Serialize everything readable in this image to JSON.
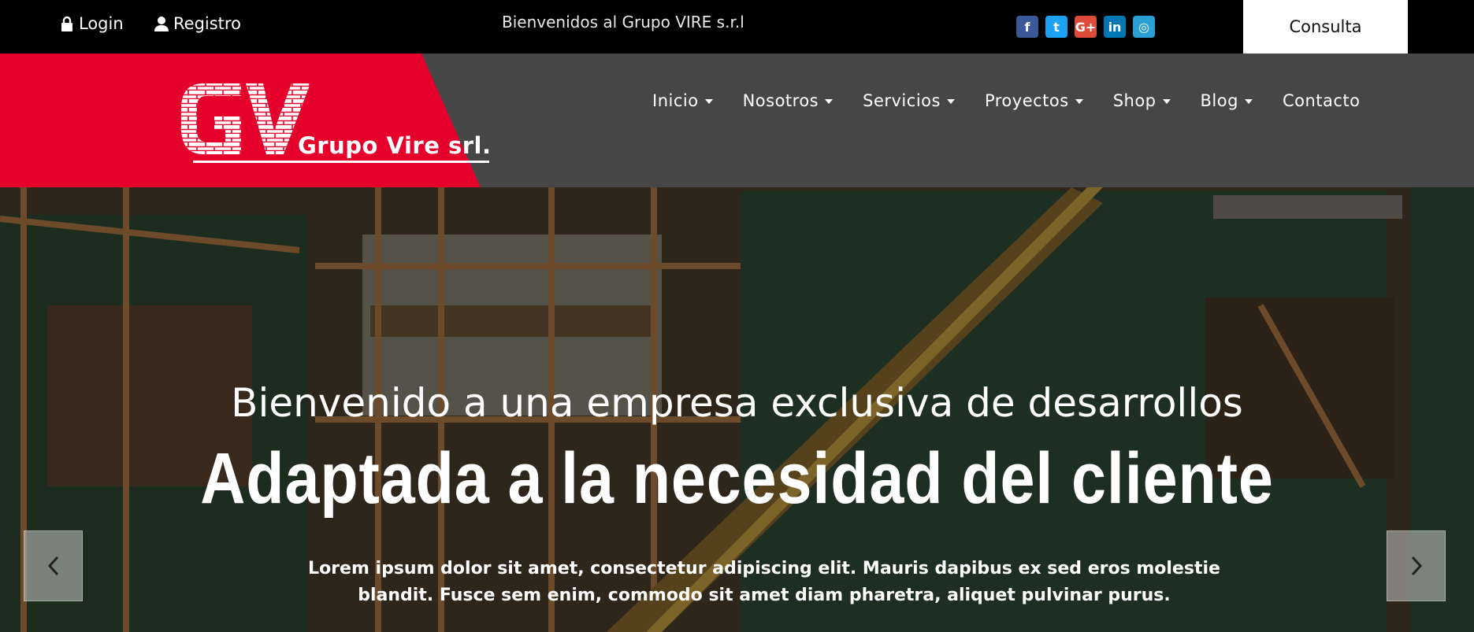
{
  "topbar": {
    "login_label": "Login",
    "register_label": "Registro",
    "welcome": "Bienvenidos al Grupo VIRE s.r.l",
    "socials": [
      {
        "icon": "facebook-icon",
        "glyph": "f",
        "color": "#3b5998"
      },
      {
        "icon": "twitter-icon",
        "glyph": "t",
        "color": "#1da1f2"
      },
      {
        "icon": "google-plus-icon",
        "glyph": "G+",
        "color": "#dd4b39"
      },
      {
        "icon": "linkedin-icon",
        "glyph": "in",
        "color": "#0077b5"
      },
      {
        "icon": "instagram-icon",
        "glyph": "◎",
        "color": "#2a9fd6"
      }
    ],
    "consulta_label": "Consulta"
  },
  "header": {
    "logo_monogram": "GV",
    "logo_text": "Grupo Vire srl.",
    "brand_color": "#e4002b",
    "nav": [
      {
        "label": "Inicio",
        "has_dropdown": true
      },
      {
        "label": "Nosotros",
        "has_dropdown": true
      },
      {
        "label": "Servicios",
        "has_dropdown": true
      },
      {
        "label": "Proyectos",
        "has_dropdown": true
      },
      {
        "label": "Shop",
        "has_dropdown": true
      },
      {
        "label": "Blog",
        "has_dropdown": true
      },
      {
        "label": "Contacto",
        "has_dropdown": false
      }
    ]
  },
  "hero": {
    "subtitle": "Bienvenido a una empresa exclusiva de desarrollos",
    "title": "Adaptada a la necesidad del cliente",
    "description": "Lorem ipsum dolor sit amet, consectetur adipiscing elit. Mauris dapibus ex sed eros molestie blandit. Fusce sem enim, commodo sit amet diam pharetra, aliquet pulvinar purus.",
    "prev_icon": "chevron-left-icon",
    "next_icon": "chevron-right-icon"
  }
}
